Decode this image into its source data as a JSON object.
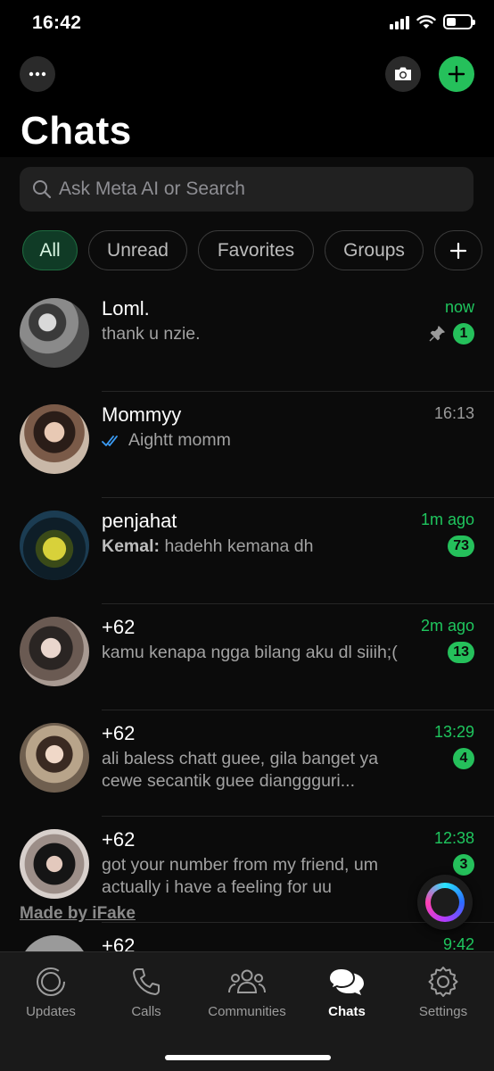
{
  "status_bar": {
    "time": "16:42"
  },
  "header": {
    "title": "Chats"
  },
  "search": {
    "placeholder": "Ask Meta AI or Search"
  },
  "filters": [
    {
      "label": "All",
      "active": true
    },
    {
      "label": "Unread",
      "active": false
    },
    {
      "label": "Favorites",
      "active": false
    },
    {
      "label": "Groups",
      "active": false
    }
  ],
  "chats": [
    {
      "name": "Loml.",
      "preview": "thank u nzie.",
      "time": "now",
      "unread": "1",
      "pinned": true
    },
    {
      "name": "Mommyy",
      "preview": "Aightt momm",
      "time": "16:13",
      "read_receipt": true
    },
    {
      "name": "penjahat",
      "sender": "Kemal:",
      "preview": "hadehh kemana dh",
      "time": "1m ago",
      "unread": "73"
    },
    {
      "name": "+62",
      "preview": "kamu kenapa ngga bilang aku dl siiih;(",
      "time": "2m ago",
      "unread": "13"
    },
    {
      "name": "+62",
      "preview": "ali baless chatt guee, gila banget ya cewe secantik guee dianggguri...",
      "time": "13:29",
      "unread": "4"
    },
    {
      "name": "+62",
      "preview": "got your number from my friend, um actually i have a feeling for uu",
      "time": "12:38",
      "unread": "3"
    },
    {
      "name": "+62",
      "preview": "",
      "time": "9:42"
    }
  ],
  "watermark": "Made by iFake",
  "tabs": [
    {
      "label": "Updates",
      "icon": "updates-icon",
      "active": false
    },
    {
      "label": "Calls",
      "icon": "phone-icon",
      "active": false
    },
    {
      "label": "Communities",
      "icon": "communities-icon",
      "active": false
    },
    {
      "label": "Chats",
      "icon": "chats-icon",
      "active": true
    },
    {
      "label": "Settings",
      "icon": "gear-icon",
      "active": false
    }
  ],
  "colors": {
    "accent": "#25c05b",
    "background": "#000000",
    "surface": "#0b0b0b",
    "read_receipt": "#3b9cf5"
  }
}
